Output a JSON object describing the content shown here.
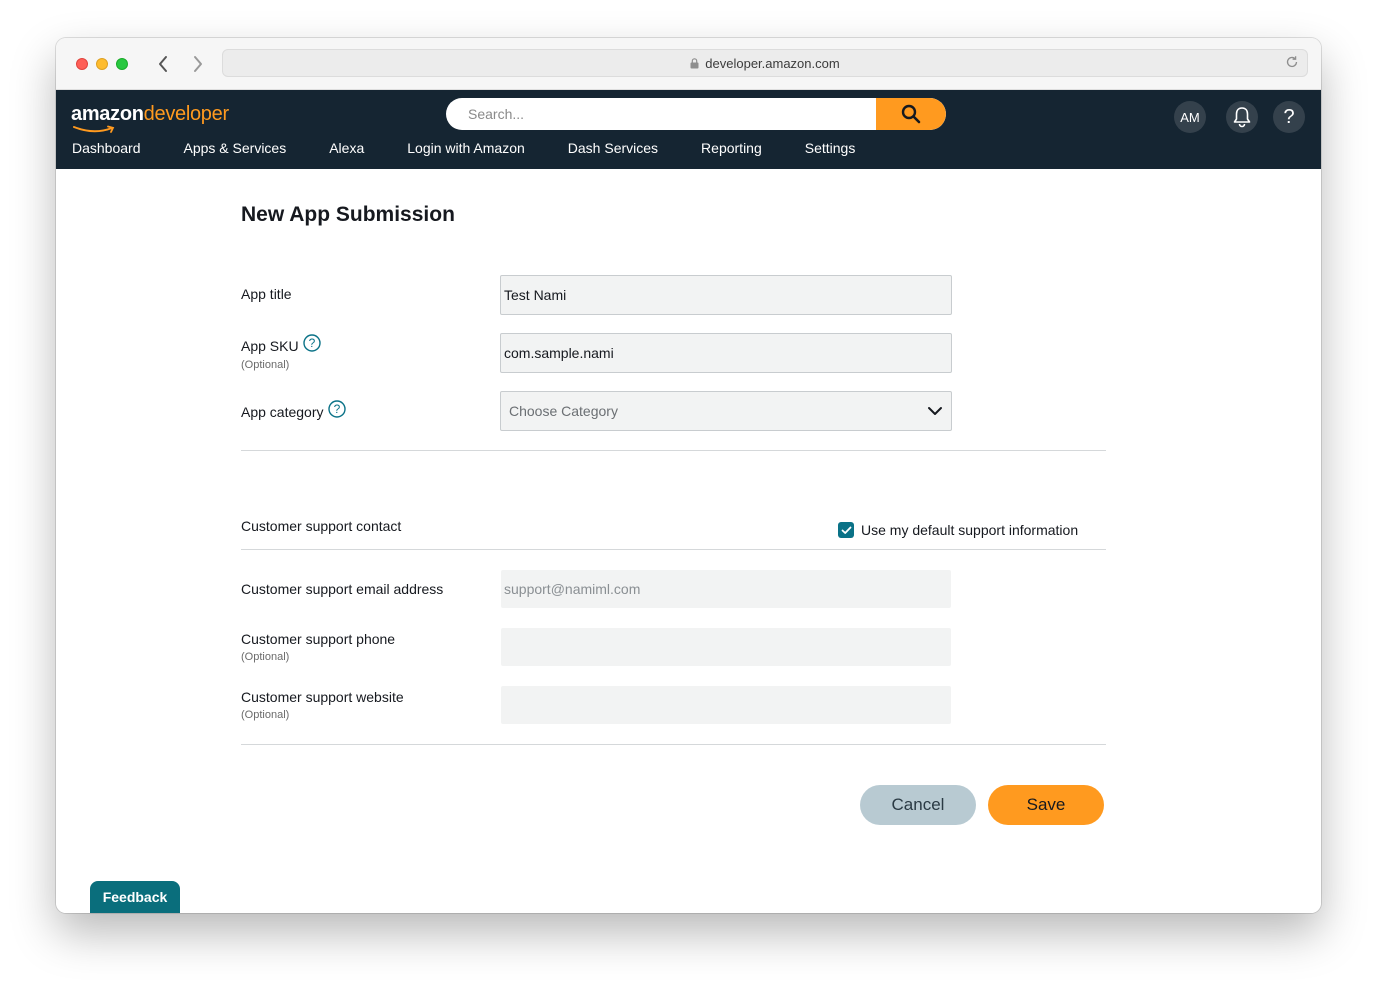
{
  "browser": {
    "url": "developer.amazon.com"
  },
  "header": {
    "logo_bold": "amazon",
    "logo_light": "developer",
    "search_placeholder": "Search...",
    "avatar_initials": "AM",
    "help_label": "?",
    "nav": [
      "Dashboard",
      "Apps & Services",
      "Alexa",
      "Login with Amazon",
      "Dash Services",
      "Reporting",
      "Settings"
    ]
  },
  "form": {
    "title": "New App Submission",
    "app_title_label": "App title",
    "app_title_value": "Test Nami",
    "app_sku_label": "App SKU",
    "app_sku_optional": "(Optional)",
    "app_sku_value": "com.sample.nami",
    "app_category_label": "App category",
    "app_category_placeholder": "Choose Category",
    "support_contact_label": "Customer support contact",
    "default_support_label": "Use my default support information",
    "default_support_checked": true,
    "support_email_label": "Customer support email address",
    "support_email_value": "support@namiml.com",
    "support_phone_label": "Customer support phone",
    "support_phone_optional": "(Optional)",
    "support_website_label": "Customer support website",
    "support_website_optional": "(Optional)",
    "cancel_label": "Cancel",
    "save_label": "Save"
  },
  "feedback_label": "Feedback",
  "colors": {
    "header_bg": "#152532",
    "accent_orange": "#ff9a1f",
    "teal": "#0a7287",
    "cancel_bg": "#b8cad2"
  }
}
